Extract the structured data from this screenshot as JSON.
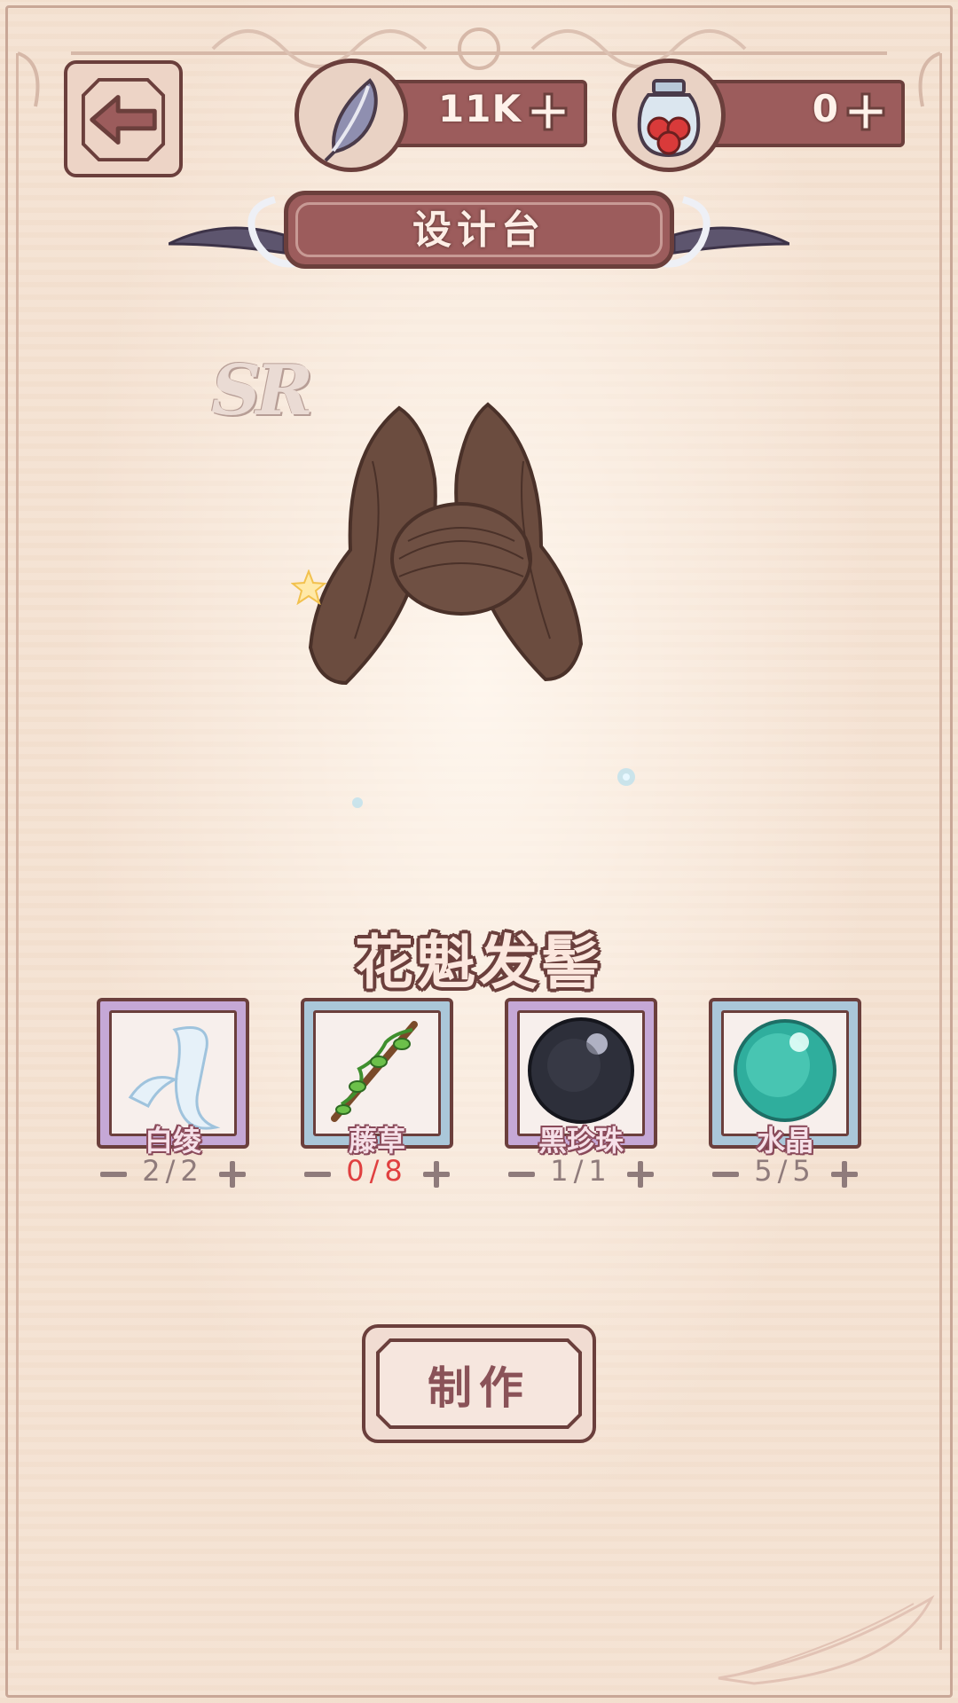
{
  "header": {
    "back_icon": "arrow-left-icon",
    "feather_currency": {
      "icon": "feather-icon",
      "value": "11K"
    },
    "jar_currency": {
      "icon": "berry-jar-icon",
      "value": "0"
    },
    "title": "设计台"
  },
  "item": {
    "rarity": "SR",
    "name": "花魁发髻",
    "art": "hair-bun-icon"
  },
  "materials": [
    {
      "name": "白绫",
      "icon": "white-silk-icon",
      "qty": "2/2",
      "sufficient": true,
      "frame": "purple"
    },
    {
      "name": "藤草",
      "icon": "vine-icon",
      "qty": "0/8",
      "sufficient": false,
      "frame": "blue"
    },
    {
      "name": "黑珍珠",
      "icon": "black-pearl-icon",
      "qty": "1/1",
      "sufficient": true,
      "frame": "purple"
    },
    {
      "name": "水晶",
      "icon": "crystal-orb-icon",
      "qty": "5/5",
      "sufficient": true,
      "frame": "blue"
    }
  ],
  "actions": {
    "make_label": "制作"
  },
  "colors": {
    "accent": "#9c5c5c",
    "outline": "#6b3f3c",
    "insufficient": "#e04040",
    "background": "#f4e1d1"
  }
}
